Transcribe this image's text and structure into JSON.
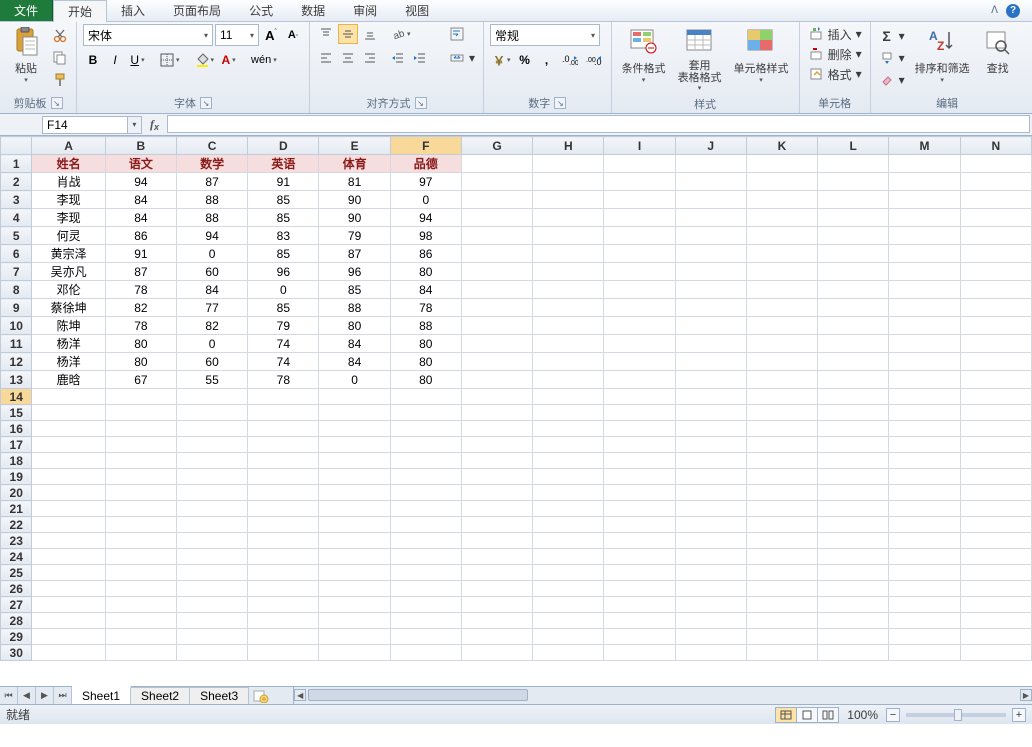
{
  "menu": {
    "file": "文件",
    "tabs": [
      "开始",
      "插入",
      "页面布局",
      "公式",
      "数据",
      "审阅",
      "视图"
    ],
    "active_tab_index": 0
  },
  "ribbon": {
    "clipboard": {
      "paste": "粘贴",
      "label": "剪贴板"
    },
    "font": {
      "name": "宋体",
      "size": "11",
      "grow": "A",
      "shrink": "A",
      "bold": "B",
      "italic": "I",
      "underline": "U",
      "label": "字体"
    },
    "alignment": {
      "wrap": "自动换行",
      "merge": "合并后居中",
      "label": "对齐方式"
    },
    "number": {
      "format": "常规",
      "label": "数字"
    },
    "styles": {
      "cond": "条件格式",
      "table": "套用\n表格格式",
      "cell": "单元格样式",
      "label": "样式"
    },
    "cells": {
      "insert": "插入",
      "delete": "删除",
      "format": "格式",
      "label": "单元格"
    },
    "editing": {
      "sort": "排序和筛选",
      "find": "查找",
      "label": "编辑"
    }
  },
  "name_box": "F14",
  "columns": [
    "A",
    "B",
    "C",
    "D",
    "E",
    "F",
    "G",
    "H",
    "I",
    "J",
    "K",
    "L",
    "M",
    "N"
  ],
  "headers": [
    "姓名",
    "语文",
    "数学",
    "英语",
    "体育",
    "品德"
  ],
  "rows": [
    [
      "肖战",
      "94",
      "87",
      "91",
      "81",
      "97"
    ],
    [
      "李现",
      "84",
      "88",
      "85",
      "90",
      "0"
    ],
    [
      "李现",
      "84",
      "88",
      "85",
      "90",
      "94"
    ],
    [
      "何灵",
      "86",
      "94",
      "83",
      "79",
      "98"
    ],
    [
      "黄宗泽",
      "91",
      "0",
      "85",
      "87",
      "86"
    ],
    [
      "吴亦凡",
      "87",
      "60",
      "96",
      "96",
      "80"
    ],
    [
      "邓伦",
      "78",
      "84",
      "0",
      "85",
      "84"
    ],
    [
      "蔡徐坤",
      "82",
      "77",
      "85",
      "88",
      "78"
    ],
    [
      "陈坤",
      "78",
      "82",
      "79",
      "80",
      "88"
    ],
    [
      "杨洋",
      "80",
      "0",
      "74",
      "84",
      "80"
    ],
    [
      "杨洋",
      "80",
      "60",
      "74",
      "84",
      "80"
    ],
    [
      "鹿晗",
      "67",
      "55",
      "78",
      "0",
      "80"
    ]
  ],
  "total_rows": 30,
  "sheets": {
    "list": [
      "Sheet1",
      "Sheet2",
      "Sheet3"
    ],
    "active": 0
  },
  "status": {
    "ready": "就绪",
    "zoom": "100%"
  }
}
